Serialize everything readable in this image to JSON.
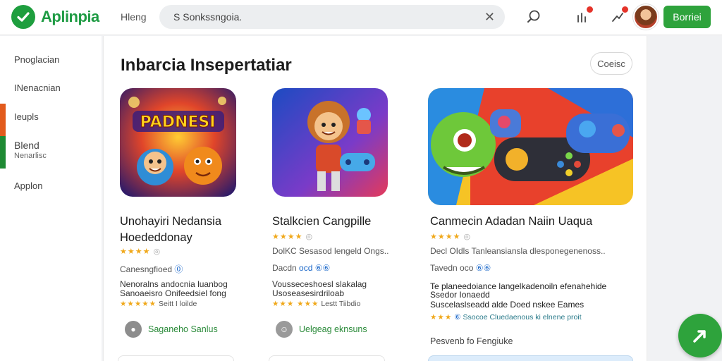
{
  "app": {
    "name": "Aplinpia",
    "nav_link": "Hleng"
  },
  "search": {
    "query": "S  Sonkssngoia."
  },
  "header": {
    "cta_label": "Borriei"
  },
  "sidebar": {
    "items": [
      {
        "label": "Pnoglacian"
      },
      {
        "label": "INenacnian"
      },
      {
        "label": "Ieupls"
      },
      {
        "label": "Blend"
      },
      {
        "label": "Nenarlisc"
      },
      {
        "label": "Applon"
      }
    ]
  },
  "main": {
    "title": "Inbarcia Insepertatiar",
    "close_label": "Coeisc"
  },
  "cards": [
    {
      "image_text": "PADNESI",
      "title_line1": "Unohayiri Nedansia",
      "title_line2": "Hoededdonay",
      "meta": "Canesngfioed",
      "desc_line1": "Nenoralns andocnia luanbog",
      "desc_line2": "Sanoaeisro Onifeedsiel fong",
      "small_meta": "Seitt I loilde",
      "action": "Saganeho Sanlus"
    },
    {
      "title_line1": "Stalkcien Cangpille",
      "meta_line": "DolKC Sesasod lengeld Ongs..",
      "meta": "Dacdn",
      "desc_line1": "Vousseceshoesl slakalag",
      "desc_line2": "Usoseasesirdriloab",
      "small_meta": "Lestt Tiibdio",
      "action": "Uelgeag eknsuns"
    },
    {
      "title_line1": "Canmecin Adadan Naiin Uaqua",
      "meta_line": "Decl OIdls Tanleansiansla dlesponegenenoss..",
      "meta": "Tavedn oco",
      "desc_line1": "Te planeedoiance langelkadenoiln efenahehide",
      "desc_line2": "Ssedor Ionaedd",
      "desc_line3": "Suscelaslseadd alde Doed nskee Eames",
      "small_meta": "Ssocoe Cluedaenous ki elnene proit",
      "footer": "Pesvenb fo Fengiuke"
    }
  ],
  "colors": {
    "brand": "#2ea33c",
    "link": "#1a67c9",
    "star": "#f0a81a",
    "sidebar_accent_top": "#e25a1c",
    "sidebar_accent_bottom": "#1e8a33"
  }
}
